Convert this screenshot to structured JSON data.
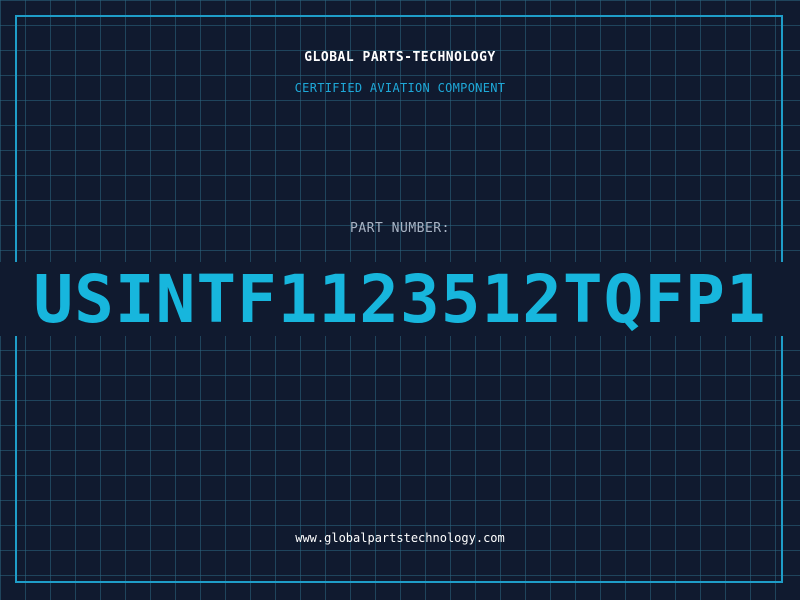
{
  "header": {
    "brand": "GLOBAL PARTS-TECHNOLOGY",
    "subtitle": "CERTIFIED AVIATION COMPONENT"
  },
  "part": {
    "label": "PART NUMBER:",
    "number": "USINTF1123512TQFP1"
  },
  "footer": {
    "url": "www.globalpartstechnology.com"
  },
  "colors": {
    "background": "#101a2f",
    "grid": "#2c6682",
    "frame": "#1f9dc8",
    "accent": "#17b6dd",
    "text": "#ffffff",
    "muted": "#a9b4c4"
  }
}
